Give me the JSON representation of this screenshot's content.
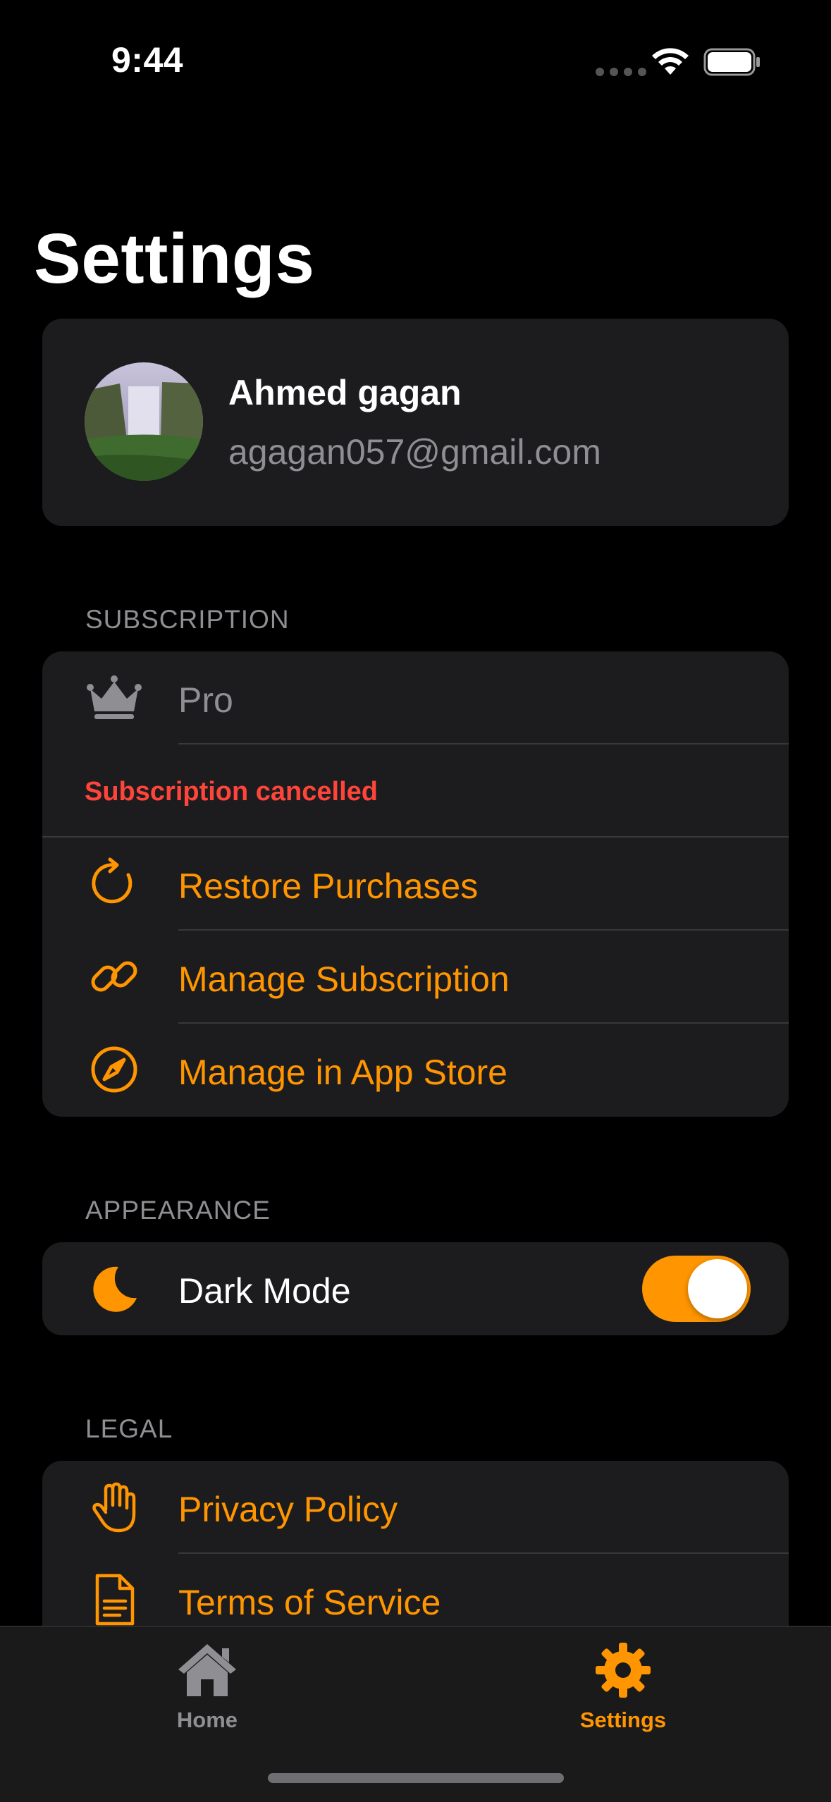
{
  "status_bar": {
    "time": "9:44"
  },
  "page": {
    "title": "Settings"
  },
  "profile": {
    "name": "Ahmed gagan",
    "email": "agagan057@gmail.com"
  },
  "subscription": {
    "header": "SUBSCRIPTION",
    "plan": "Pro",
    "status": "Subscription cancelled",
    "items": [
      {
        "label": "Restore Purchases",
        "icon": "restore-icon"
      },
      {
        "label": "Manage Subscription",
        "icon": "link-icon"
      },
      {
        "label": "Manage in App Store",
        "icon": "compass-icon"
      }
    ]
  },
  "appearance": {
    "header": "APPEARANCE",
    "dark_mode_label": "Dark Mode",
    "dark_mode_on": true
  },
  "legal": {
    "header": "LEGAL",
    "items": [
      {
        "label": "Privacy Policy",
        "icon": "hand-icon"
      },
      {
        "label": "Terms of Service",
        "icon": "document-icon"
      }
    ]
  },
  "tab_bar": {
    "tabs": [
      {
        "label": "Home",
        "icon": "home-icon",
        "selected": false
      },
      {
        "label": "Settings",
        "icon": "gear-icon",
        "selected": true
      }
    ]
  },
  "colors": {
    "accent": "#ff9500",
    "danger": "#ff453a",
    "card": "#1c1c1e",
    "secondary_text": "#8e8e93"
  }
}
